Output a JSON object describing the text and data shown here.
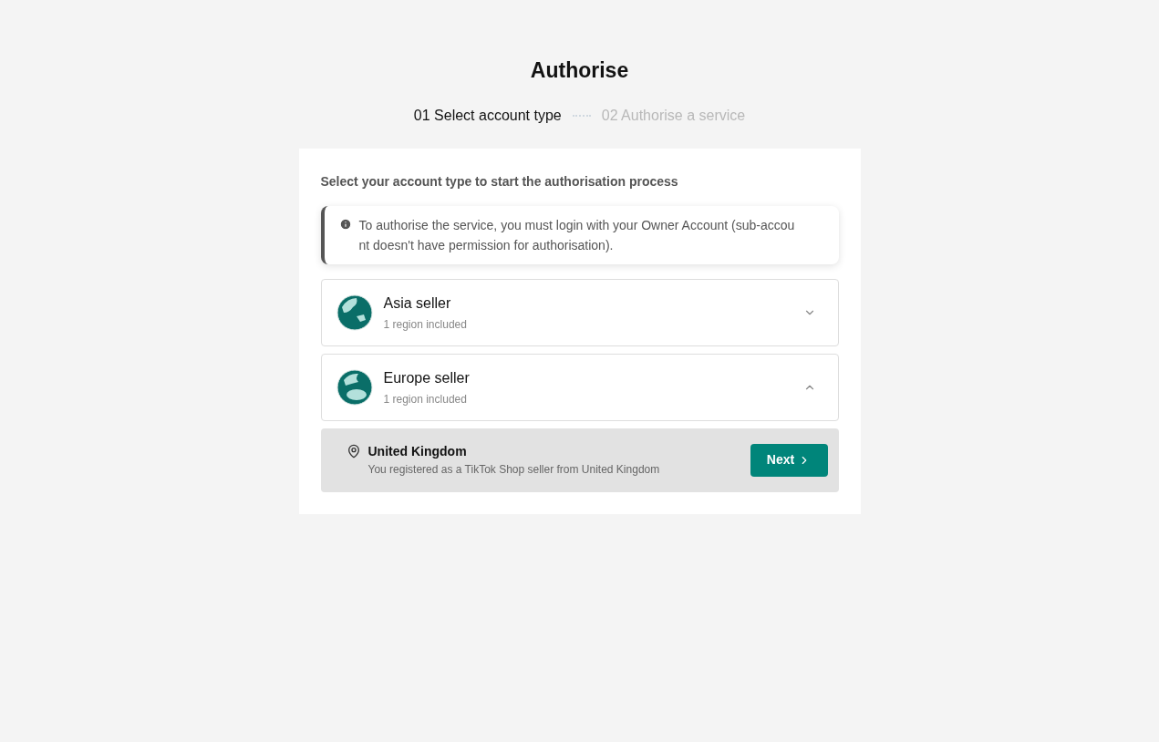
{
  "title": "Authorise",
  "steps": [
    {
      "label": "01 Select account type",
      "selected": true
    },
    {
      "label": "02 Authorise a service",
      "selected": false
    }
  ],
  "prompt": "Select your account type to start the authorisation process",
  "notice": "To authorise the service, you must login with your Owner Account (sub-account doesn't have permission for authorisation).",
  "accounts": [
    {
      "name": "Asia seller",
      "subtitle": "1 region included",
      "expanded": false
    },
    {
      "name": "Europe seller",
      "subtitle": "1 region included",
      "expanded": true,
      "regions": [
        {
          "name": "United Kingdom",
          "description": "You registered as a TikTok Shop seller from United Kingdom",
          "button": "Next"
        }
      ]
    }
  ]
}
